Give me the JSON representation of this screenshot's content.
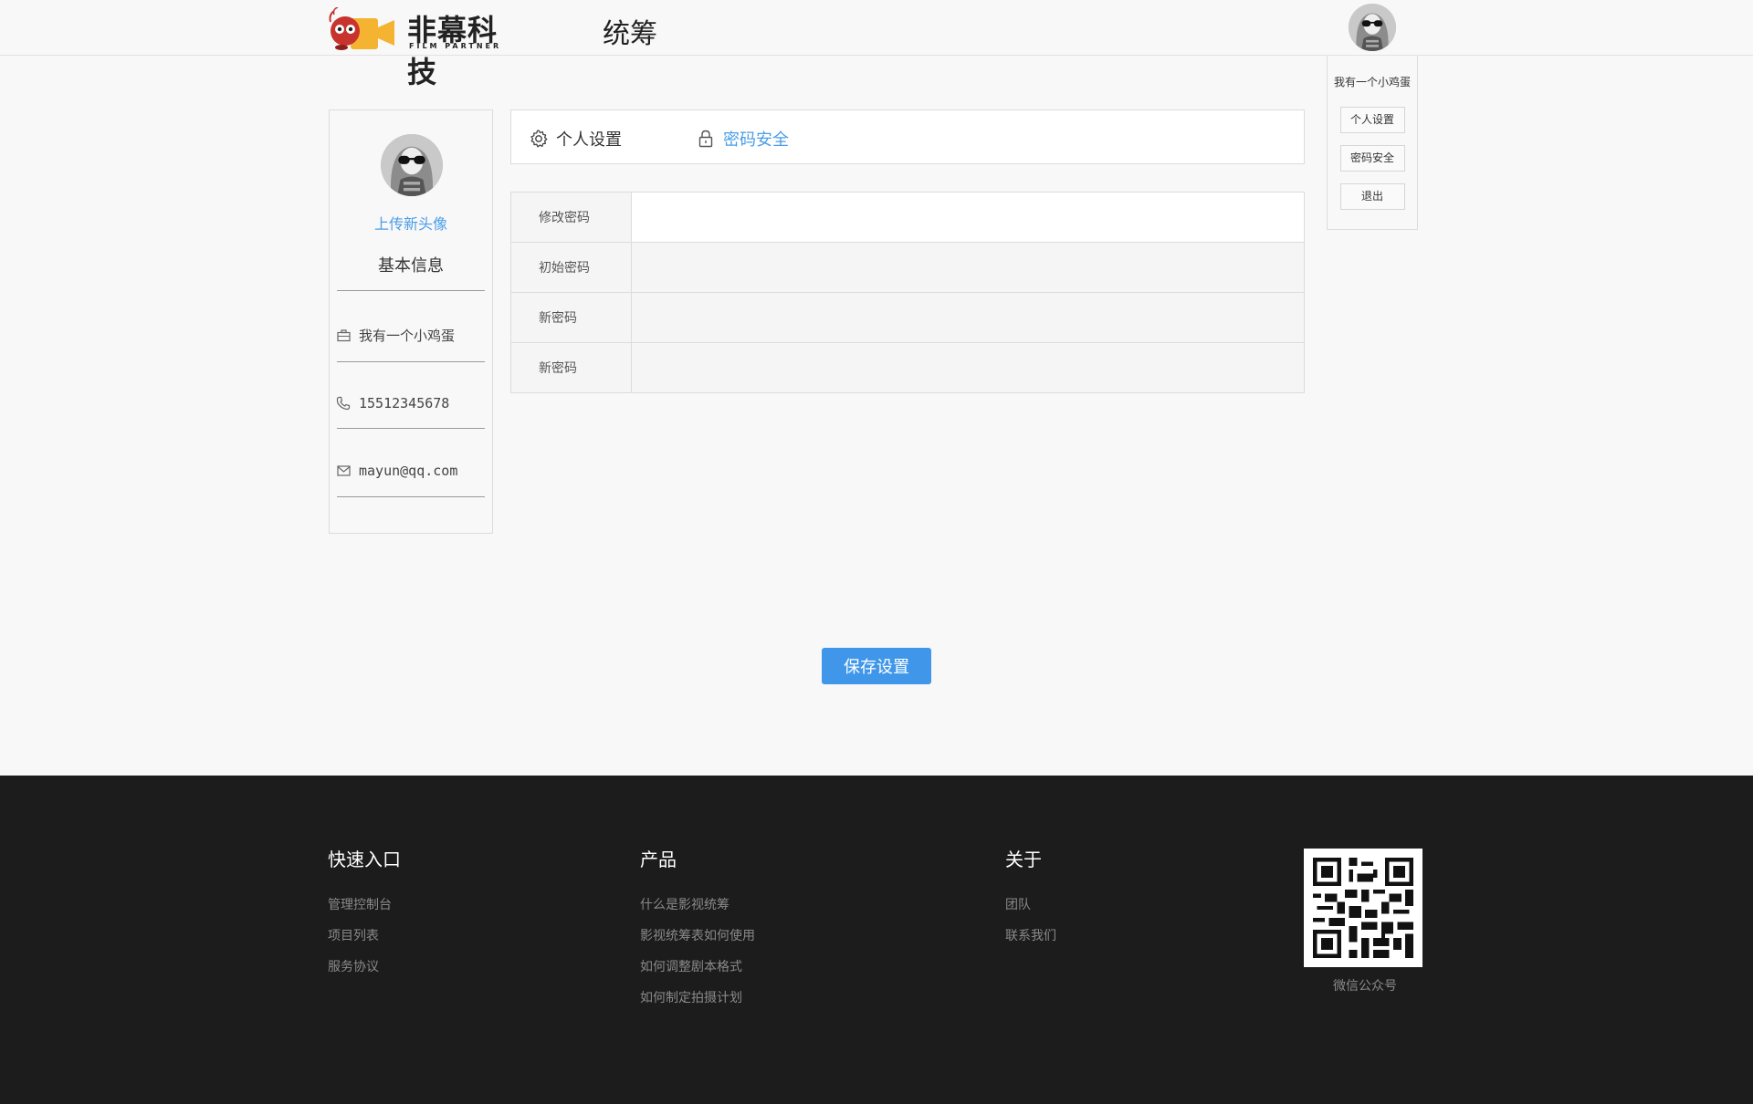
{
  "header": {
    "brand_cn": "非幕科技",
    "brand_en": "FILM PARTNER",
    "title": "统筹"
  },
  "user_menu": {
    "username": "我有一个小鸡蛋",
    "items": [
      "个人设置",
      "密码安全",
      "退出"
    ]
  },
  "profile": {
    "upload_label": "上传新头像",
    "section_title": "基本信息",
    "name": "我有一个小鸡蛋",
    "phone": "15512345678",
    "email": "mayun@qq.com"
  },
  "tabs": {
    "personal": "个人设置",
    "security": "密码安全"
  },
  "password_form": {
    "rows": [
      {
        "label": "修改密码",
        "value": ""
      },
      {
        "label": "初始密码",
        "value": ""
      },
      {
        "label": "新密码",
        "value": ""
      },
      {
        "label": "新密码",
        "value": ""
      }
    ]
  },
  "save_label": "保存设置",
  "footer": {
    "quick": {
      "title": "快速入口",
      "links": [
        "管理控制台",
        "项目列表",
        "服务协议"
      ]
    },
    "product": {
      "title": "产品",
      "links": [
        "什么是影视统筹",
        "影视统筹表如何使用",
        "如何调整剧本格式",
        "如何制定拍摄计划"
      ]
    },
    "about": {
      "title": "关于",
      "links": [
        "团队",
        "联系我们"
      ]
    },
    "qr_label": "微信公众号"
  },
  "colors": {
    "accent": "#4097ea",
    "link": "#4a9de8",
    "footer_bg": "#1c1c1c"
  }
}
